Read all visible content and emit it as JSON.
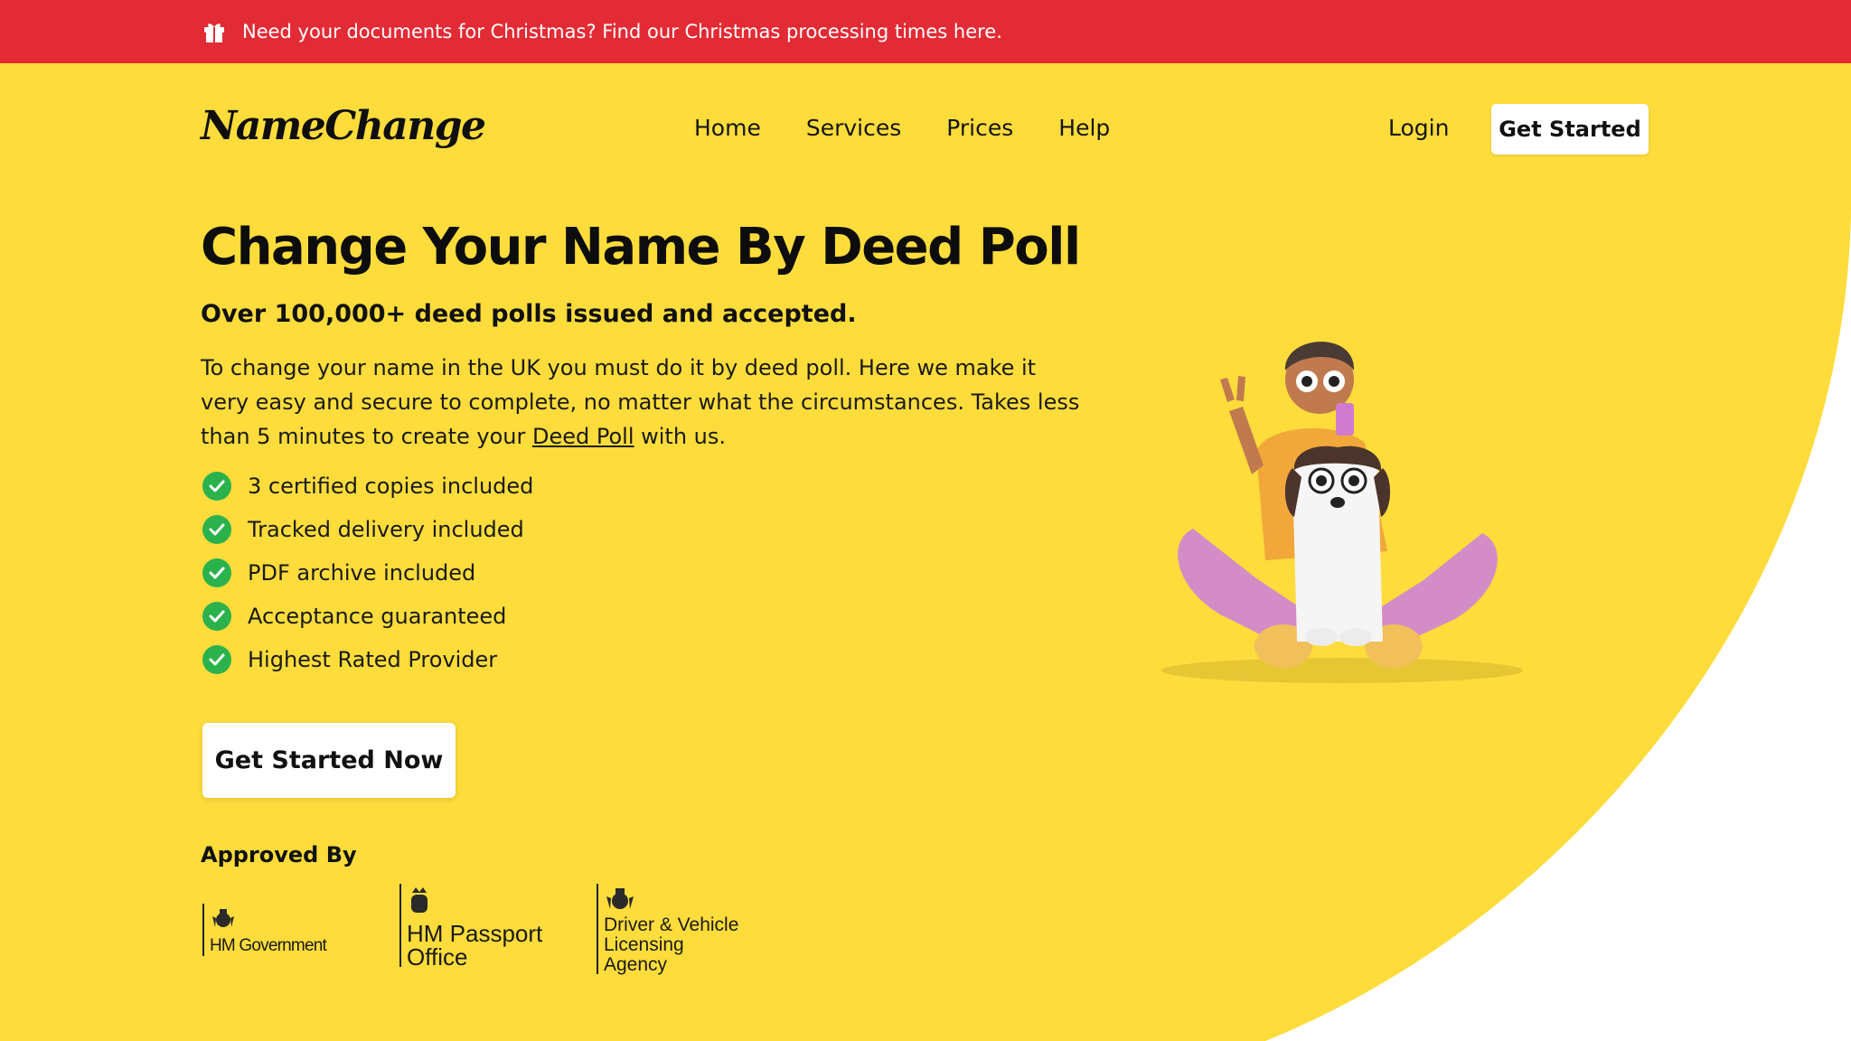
{
  "colors": {
    "hero_yellow": "#fddc3c",
    "topbar_red": "#e32b35",
    "check_green": "#2bb24c",
    "white": "#ffffff"
  },
  "announcement": {
    "icon": "gift-icon",
    "text": "Need your documents for Christmas? Find our Christmas processing times here."
  },
  "header": {
    "logo": "NameChange",
    "nav": [
      "Home",
      "Services",
      "Prices",
      "Help"
    ],
    "login": "Login",
    "cta": "Get Started"
  },
  "hero": {
    "title": "Change Your Name By Deed Poll",
    "subtitle": "Over 100,000+ deed polls issued and accepted.",
    "intro_before_link": "To change your name in the UK you must do it by deed poll. Here we make it very easy and secure to complete, no matter what the circumstances. Takes less than 5 minutes to create your ",
    "intro_link": "Deed Poll",
    "intro_after_link": " with us.",
    "features": [
      "3 certified copies included",
      "Tracked delivery included",
      "PDF archive included",
      "Acceptance guaranteed",
      "Highest Rated Provider"
    ],
    "cta": "Get Started Now",
    "approved_label": "Approved By",
    "approvers": [
      {
        "name": "HM Government"
      },
      {
        "name": "HM Passport Office",
        "lines": [
          "HM Passport",
          "Office"
        ]
      },
      {
        "name": "Driver & Vehicle Licensing Agency",
        "lines": [
          "Driver & Vehicle",
          "Licensing",
          "Agency"
        ]
      }
    ],
    "illustration": "person-with-dog-illustration"
  }
}
